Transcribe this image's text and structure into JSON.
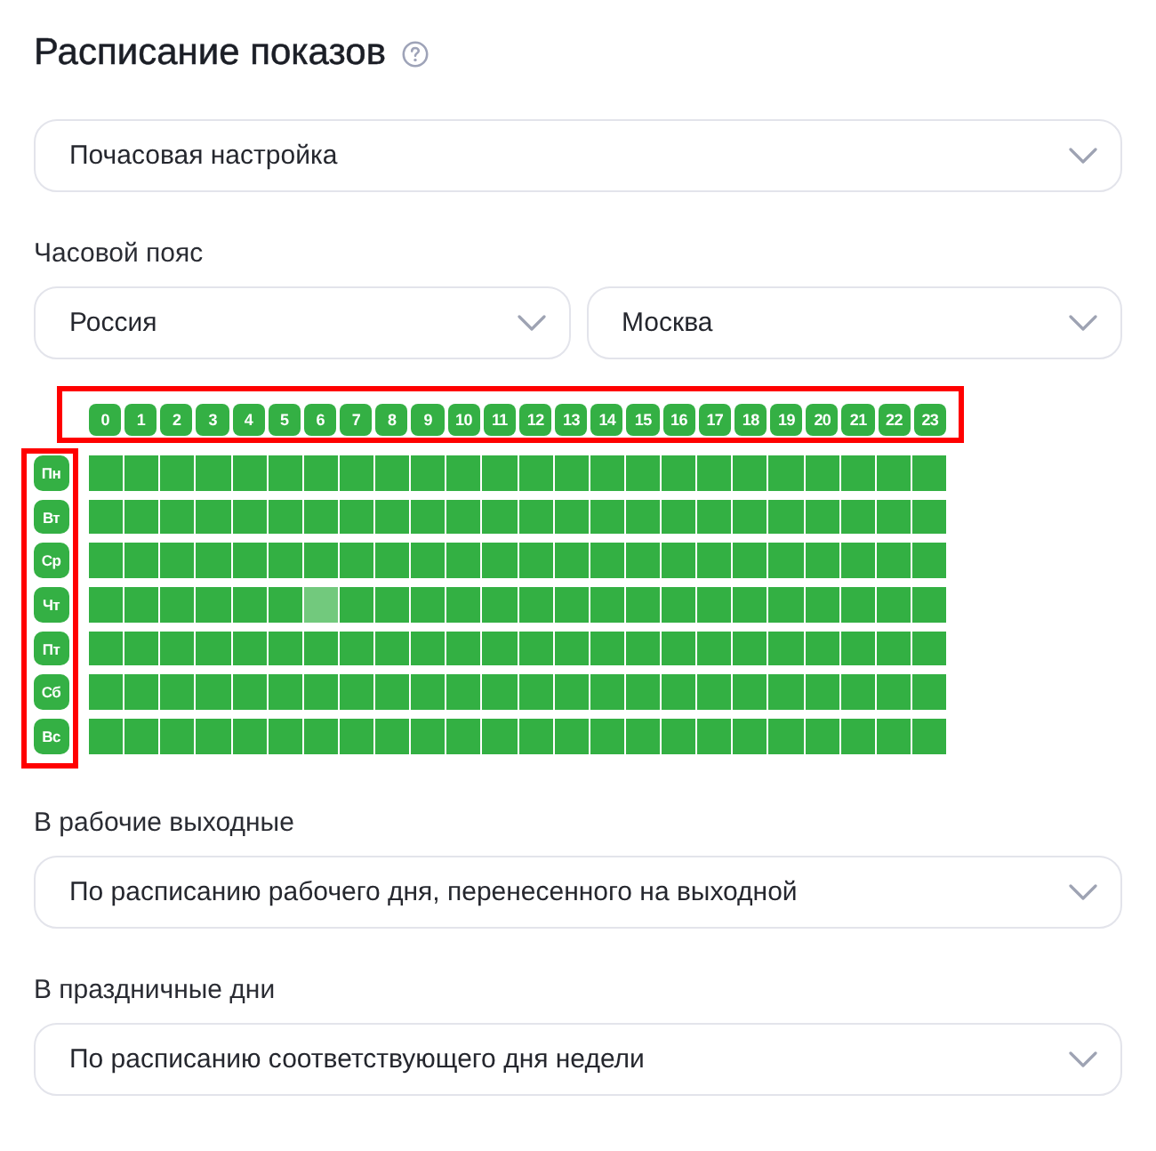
{
  "title": "Расписание показов",
  "mode_select": {
    "value": "Почасовая настройка"
  },
  "timezone": {
    "label": "Часовой пояс",
    "selects": [
      {
        "value": "Россия"
      },
      {
        "value": "Москва"
      }
    ]
  },
  "schedule": {
    "hours": {
      "highlighted": true,
      "labels": [
        "0",
        "1",
        "2",
        "3",
        "4",
        "5",
        "6",
        "7",
        "8",
        "9",
        "10",
        "11",
        "12",
        "13",
        "14",
        "15",
        "16",
        "17",
        "18",
        "19",
        "20",
        "21",
        "22",
        "23"
      ]
    },
    "days": {
      "highlighted": true
    },
    "rows": [
      {
        "day": "Пн",
        "cells": [
          {
            "on": true,
            "hovered": false
          },
          {
            "on": true,
            "hovered": false
          },
          {
            "on": true,
            "hovered": false
          },
          {
            "on": true,
            "hovered": false
          },
          {
            "on": true,
            "hovered": false
          },
          {
            "on": true,
            "hovered": false
          },
          {
            "on": true,
            "hovered": false
          },
          {
            "on": true,
            "hovered": false
          },
          {
            "on": true,
            "hovered": false
          },
          {
            "on": true,
            "hovered": false
          },
          {
            "on": true,
            "hovered": false
          },
          {
            "on": true,
            "hovered": false
          },
          {
            "on": true,
            "hovered": false
          },
          {
            "on": true,
            "hovered": false
          },
          {
            "on": true,
            "hovered": false
          },
          {
            "on": true,
            "hovered": false
          },
          {
            "on": true,
            "hovered": false
          },
          {
            "on": true,
            "hovered": false
          },
          {
            "on": true,
            "hovered": false
          },
          {
            "on": true,
            "hovered": false
          },
          {
            "on": true,
            "hovered": false
          },
          {
            "on": true,
            "hovered": false
          },
          {
            "on": true,
            "hovered": false
          },
          {
            "on": true,
            "hovered": false
          }
        ]
      },
      {
        "day": "Вт",
        "cells": [
          {
            "on": true,
            "hovered": false
          },
          {
            "on": true,
            "hovered": false
          },
          {
            "on": true,
            "hovered": false
          },
          {
            "on": true,
            "hovered": false
          },
          {
            "on": true,
            "hovered": false
          },
          {
            "on": true,
            "hovered": false
          },
          {
            "on": true,
            "hovered": false
          },
          {
            "on": true,
            "hovered": false
          },
          {
            "on": true,
            "hovered": false
          },
          {
            "on": true,
            "hovered": false
          },
          {
            "on": true,
            "hovered": false
          },
          {
            "on": true,
            "hovered": false
          },
          {
            "on": true,
            "hovered": false
          },
          {
            "on": true,
            "hovered": false
          },
          {
            "on": true,
            "hovered": false
          },
          {
            "on": true,
            "hovered": false
          },
          {
            "on": true,
            "hovered": false
          },
          {
            "on": true,
            "hovered": false
          },
          {
            "on": true,
            "hovered": false
          },
          {
            "on": true,
            "hovered": false
          },
          {
            "on": true,
            "hovered": false
          },
          {
            "on": true,
            "hovered": false
          },
          {
            "on": true,
            "hovered": false
          },
          {
            "on": true,
            "hovered": false
          }
        ]
      },
      {
        "day": "Ср",
        "cells": [
          {
            "on": true,
            "hovered": false
          },
          {
            "on": true,
            "hovered": false
          },
          {
            "on": true,
            "hovered": false
          },
          {
            "on": true,
            "hovered": false
          },
          {
            "on": true,
            "hovered": false
          },
          {
            "on": true,
            "hovered": false
          },
          {
            "on": true,
            "hovered": false
          },
          {
            "on": true,
            "hovered": false
          },
          {
            "on": true,
            "hovered": false
          },
          {
            "on": true,
            "hovered": false
          },
          {
            "on": true,
            "hovered": false
          },
          {
            "on": true,
            "hovered": false
          },
          {
            "on": true,
            "hovered": false
          },
          {
            "on": true,
            "hovered": false
          },
          {
            "on": true,
            "hovered": false
          },
          {
            "on": true,
            "hovered": false
          },
          {
            "on": true,
            "hovered": false
          },
          {
            "on": true,
            "hovered": false
          },
          {
            "on": true,
            "hovered": false
          },
          {
            "on": true,
            "hovered": false
          },
          {
            "on": true,
            "hovered": false
          },
          {
            "on": true,
            "hovered": false
          },
          {
            "on": true,
            "hovered": false
          },
          {
            "on": true,
            "hovered": false
          }
        ]
      },
      {
        "day": "Чт",
        "cells": [
          {
            "on": true,
            "hovered": false
          },
          {
            "on": true,
            "hovered": false
          },
          {
            "on": true,
            "hovered": false
          },
          {
            "on": true,
            "hovered": false
          },
          {
            "on": true,
            "hovered": false
          },
          {
            "on": true,
            "hovered": false
          },
          {
            "on": true,
            "hovered": true
          },
          {
            "on": true,
            "hovered": false
          },
          {
            "on": true,
            "hovered": false
          },
          {
            "on": true,
            "hovered": false
          },
          {
            "on": true,
            "hovered": false
          },
          {
            "on": true,
            "hovered": false
          },
          {
            "on": true,
            "hovered": false
          },
          {
            "on": true,
            "hovered": false
          },
          {
            "on": true,
            "hovered": false
          },
          {
            "on": true,
            "hovered": false
          },
          {
            "on": true,
            "hovered": false
          },
          {
            "on": true,
            "hovered": false
          },
          {
            "on": true,
            "hovered": false
          },
          {
            "on": true,
            "hovered": false
          },
          {
            "on": true,
            "hovered": false
          },
          {
            "on": true,
            "hovered": false
          },
          {
            "on": true,
            "hovered": false
          },
          {
            "on": true,
            "hovered": false
          }
        ]
      },
      {
        "day": "Пт",
        "cells": [
          {
            "on": true,
            "hovered": false
          },
          {
            "on": true,
            "hovered": false
          },
          {
            "on": true,
            "hovered": false
          },
          {
            "on": true,
            "hovered": false
          },
          {
            "on": true,
            "hovered": false
          },
          {
            "on": true,
            "hovered": false
          },
          {
            "on": true,
            "hovered": false
          },
          {
            "on": true,
            "hovered": false
          },
          {
            "on": true,
            "hovered": false
          },
          {
            "on": true,
            "hovered": false
          },
          {
            "on": true,
            "hovered": false
          },
          {
            "on": true,
            "hovered": false
          },
          {
            "on": true,
            "hovered": false
          },
          {
            "on": true,
            "hovered": false
          },
          {
            "on": true,
            "hovered": false
          },
          {
            "on": true,
            "hovered": false
          },
          {
            "on": true,
            "hovered": false
          },
          {
            "on": true,
            "hovered": false
          },
          {
            "on": true,
            "hovered": false
          },
          {
            "on": true,
            "hovered": false
          },
          {
            "on": true,
            "hovered": false
          },
          {
            "on": true,
            "hovered": false
          },
          {
            "on": true,
            "hovered": false
          },
          {
            "on": true,
            "hovered": false
          }
        ]
      },
      {
        "day": "Сб",
        "cells": [
          {
            "on": true,
            "hovered": false
          },
          {
            "on": true,
            "hovered": false
          },
          {
            "on": true,
            "hovered": false
          },
          {
            "on": true,
            "hovered": false
          },
          {
            "on": true,
            "hovered": false
          },
          {
            "on": true,
            "hovered": false
          },
          {
            "on": true,
            "hovered": false
          },
          {
            "on": true,
            "hovered": false
          },
          {
            "on": true,
            "hovered": false
          },
          {
            "on": true,
            "hovered": false
          },
          {
            "on": true,
            "hovered": false
          },
          {
            "on": true,
            "hovered": false
          },
          {
            "on": true,
            "hovered": false
          },
          {
            "on": true,
            "hovered": false
          },
          {
            "on": true,
            "hovered": false
          },
          {
            "on": true,
            "hovered": false
          },
          {
            "on": true,
            "hovered": false
          },
          {
            "on": true,
            "hovered": false
          },
          {
            "on": true,
            "hovered": false
          },
          {
            "on": true,
            "hovered": false
          },
          {
            "on": true,
            "hovered": false
          },
          {
            "on": true,
            "hovered": false
          },
          {
            "on": true,
            "hovered": false
          },
          {
            "on": true,
            "hovered": false
          }
        ]
      },
      {
        "day": "Вс",
        "cells": [
          {
            "on": true,
            "hovered": false
          },
          {
            "on": true,
            "hovered": false
          },
          {
            "on": true,
            "hovered": false
          },
          {
            "on": true,
            "hovered": false
          },
          {
            "on": true,
            "hovered": false
          },
          {
            "on": true,
            "hovered": false
          },
          {
            "on": true,
            "hovered": false
          },
          {
            "on": true,
            "hovered": false
          },
          {
            "on": true,
            "hovered": false
          },
          {
            "on": true,
            "hovered": false
          },
          {
            "on": true,
            "hovered": false
          },
          {
            "on": true,
            "hovered": false
          },
          {
            "on": true,
            "hovered": false
          },
          {
            "on": true,
            "hovered": false
          },
          {
            "on": true,
            "hovered": false
          },
          {
            "on": true,
            "hovered": false
          },
          {
            "on": true,
            "hovered": false
          },
          {
            "on": true,
            "hovered": false
          },
          {
            "on": true,
            "hovered": false
          },
          {
            "on": true,
            "hovered": false
          },
          {
            "on": true,
            "hovered": false
          },
          {
            "on": true,
            "hovered": false
          },
          {
            "on": true,
            "hovered": false
          },
          {
            "on": true,
            "hovered": false
          }
        ]
      }
    ]
  },
  "working_weekends": {
    "label": "В рабочие выходные",
    "value": "По расписанию рабочего дня, перенесенного на выходной"
  },
  "holidays": {
    "label": "В праздничные дни",
    "value": "По расписанию соответствующего дня недели"
  }
}
